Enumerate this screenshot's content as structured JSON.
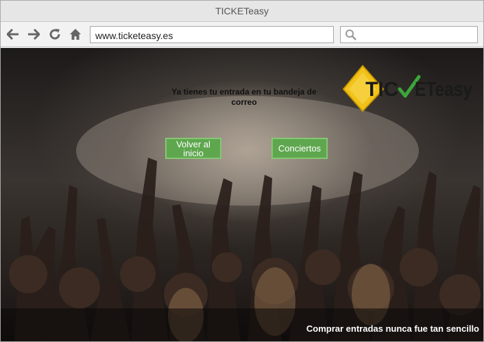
{
  "window": {
    "title": "TICKETeasy"
  },
  "toolbar": {
    "url": "www.ticketeasy.es",
    "search_placeholder": "",
    "icons": [
      "back-arrow-icon",
      "forward-arrow-icon",
      "reload-icon",
      "home-icon",
      "search-icon"
    ]
  },
  "page": {
    "message_line1": "Ya tienes tu entrada en tu bandeja de",
    "message_line2": "correo",
    "logo": {
      "part1": "TIC",
      "part2": "ETeasy"
    },
    "buttons": {
      "volver_line1": "Volver al",
      "volver_line2": "inicio",
      "conciertos": "Conciertos"
    },
    "slogan": "Comprar entradas nunca fue tan sencillo"
  },
  "colors": {
    "button_green": "#5fa74f",
    "logo_yellow": "#f2c21b",
    "check_green": "#3aa63a"
  }
}
